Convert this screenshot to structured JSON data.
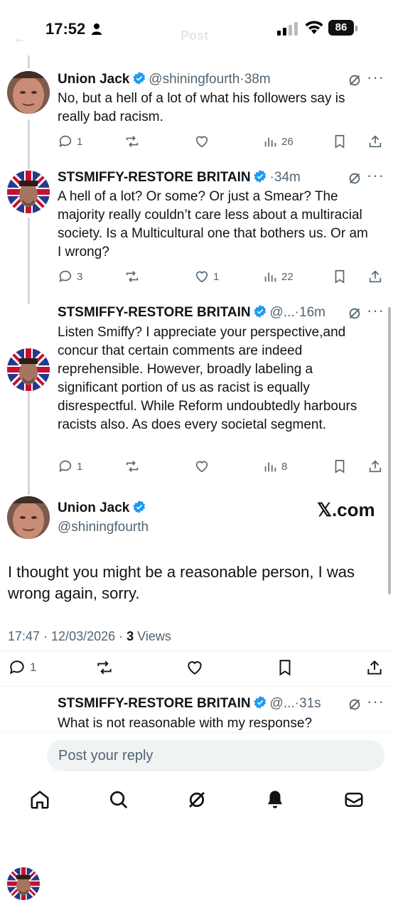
{
  "status_bar": {
    "time": "17:52",
    "battery": "86",
    "back_label": "←",
    "title": "Post"
  },
  "tweets": [
    {
      "name": "Union Jack",
      "handle": "@shiningfourth",
      "time": "38m",
      "text": "No, but a hell of a lot of what his followers say is really bad racism.",
      "replies": "1",
      "likes": "",
      "views": "26"
    },
    {
      "name": "STSMIFFY-RESTORE BRITAIN",
      "handle": "",
      "time": "34m",
      "text": "A hell of a lot? Or some? Or just a Smear? The majority really couldn’t care less about a multiracial society. Is a Multicultural one that bothers us. Or am I wrong?",
      "replies": "3",
      "likes": "1",
      "views": "22"
    },
    {
      "name": "STSMIFFY-RESTORE BRITAIN",
      "handle": "@...",
      "time": "16m",
      "text": "Listen Smiffy? I appreciate your perspective,and concur that certain comments are indeed reprehensible. However, broadly labeling a significant portion of us as racist is equally disrespectful. While Reform undoubtedly harbours racists also. As does every societal segment.",
      "replies": "1",
      "likes": "",
      "views": "8"
    }
  ],
  "main_post": {
    "name": "Union Jack",
    "handle": "@shiningfourth",
    "watermark": "𝕏.com",
    "text": "I thought you might be a reasonable person, I was wrong again, sorry.",
    "timestamp": "17:47 · 12/03/2026 · ",
    "views_count": "3",
    "views_label": " Views",
    "replies": "1"
  },
  "reply_tweet": {
    "name": "STSMIFFY-RESTORE BRITAIN",
    "handle": "@...",
    "time": "31s",
    "text": "What is not reasonable with my response?"
  },
  "composer": {
    "placeholder": "Post your reply"
  },
  "icons": [
    "reply-icon",
    "repost-icon",
    "like-icon",
    "views-icon",
    "bookmark-icon",
    "share-icon",
    "grok-icon",
    "home-icon",
    "search-icon",
    "bell-icon",
    "mail-icon"
  ],
  "colors": {
    "accent": "#1d9bf0",
    "muted": "#536471",
    "text": "#0f1419"
  }
}
